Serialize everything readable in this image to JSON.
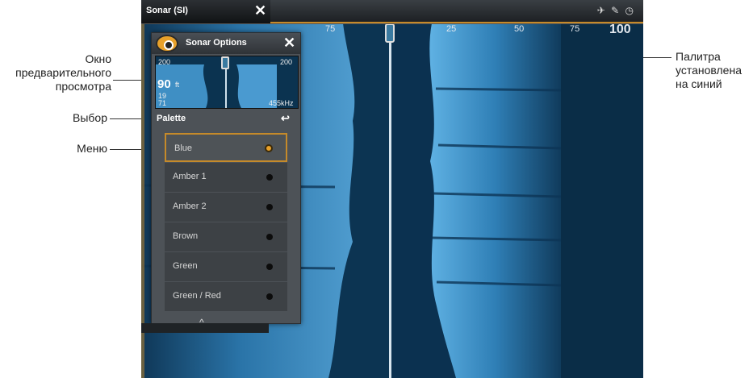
{
  "annotations": {
    "preview_window": "Окно\nпредварительного\nпросмотра",
    "selection": "Выбор",
    "menu": "Меню",
    "palette_note": "Палитра\nустановлена\nна синий"
  },
  "screen": {
    "title": "Sonar (SI)",
    "close_glyph": "✕",
    "status_icons": "✈ ✎ ◷",
    "scale": {
      "tick_25_left": "75",
      "tick_25_right": "25",
      "tick_50": "50",
      "tick_75": "75",
      "tick_100": "100"
    }
  },
  "options_panel": {
    "title": "Sonar Options",
    "close_glyph": "✕",
    "preview": {
      "range_left": "200",
      "range_right": "200",
      "depth": "90",
      "depth_unit": "ft",
      "temp": "19",
      "speed": "71",
      "freq": "455kHz"
    },
    "submenu_title": "Palette",
    "back_glyph": "↩",
    "palettes": [
      "Blue",
      "Amber 1",
      "Amber 2",
      "Brown",
      "Green",
      "Green / Red"
    ],
    "selected_palette": "Blue"
  },
  "colors": {
    "accent": "#c58a2a",
    "water": "#0a2d47",
    "bottom": "#4a9ad0"
  }
}
